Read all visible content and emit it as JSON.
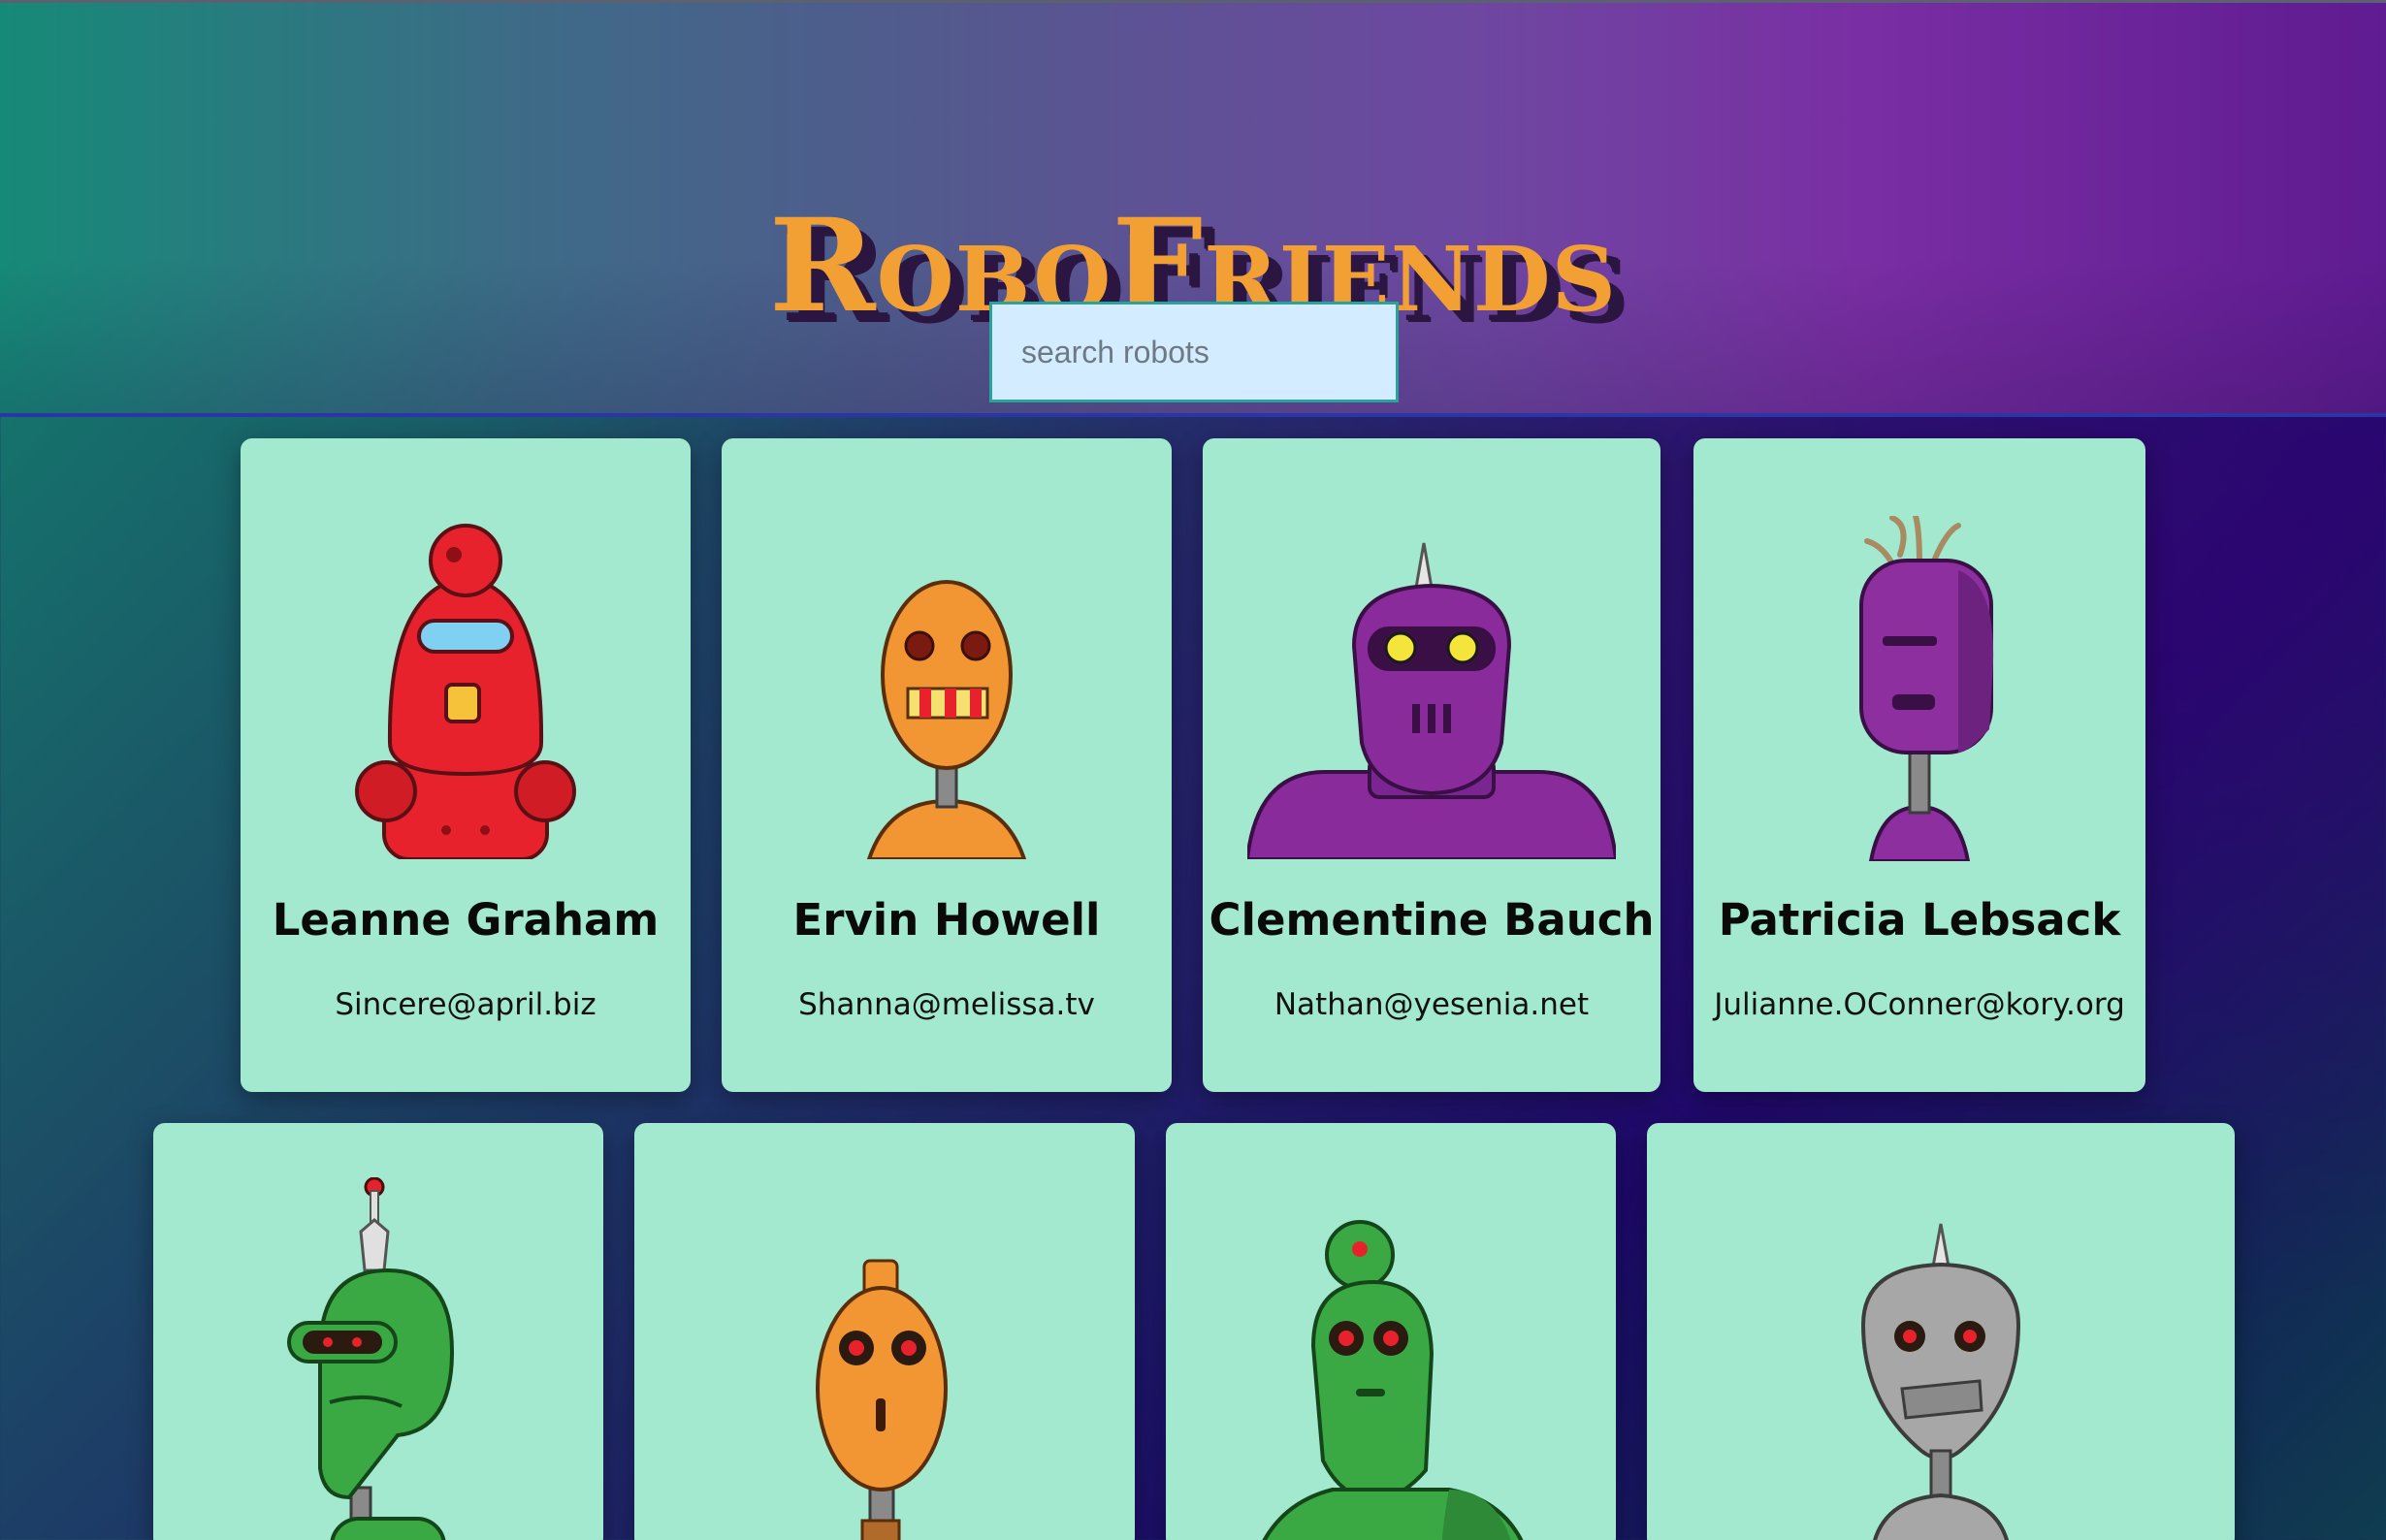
{
  "app": {
    "title": "RoboFriends"
  },
  "search": {
    "placeholder": "search robots",
    "value": ""
  },
  "robots": [
    {
      "name": "Leanne Graham",
      "email": "Sincere@april.biz",
      "color": "#e8222c",
      "icon": "red-robot-illustration"
    },
    {
      "name": "Ervin Howell",
      "email": "Shanna@melissa.tv",
      "color": "#f29634",
      "icon": "orange-robot-illustration"
    },
    {
      "name": "Clementine Bauch",
      "email": "Nathan@yesenia.net",
      "color": "#8a2b9b",
      "icon": "purple-robot-illustration"
    },
    {
      "name": "Patricia Lebsack",
      "email": "Julianne.OConner@kory.org",
      "color": "#8d2f9e",
      "icon": "purple-robot-illustration"
    },
    {
      "name": "",
      "email": "",
      "color": "#3aa843",
      "icon": "green-robot-illustration"
    },
    {
      "name": "",
      "email": "",
      "color": "#f29634",
      "icon": "orange-robot-illustration"
    },
    {
      "name": "",
      "email": "",
      "color": "#3aa843",
      "icon": "green-robot-illustration"
    },
    {
      "name": "",
      "email": "",
      "color": "#a7a7a7",
      "icon": "gray-robot-illustration"
    }
  ],
  "colors": {
    "card_background": "#a2e9d0",
    "title_color": "#f2a033",
    "search_background": "#d4ecff"
  }
}
